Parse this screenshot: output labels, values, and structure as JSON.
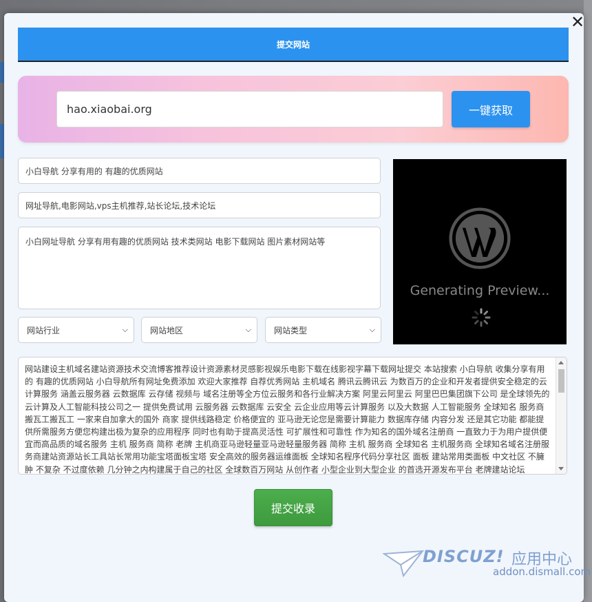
{
  "dialog": {
    "title": "提交网站",
    "close_symbol": "✕"
  },
  "fetch": {
    "url_value": "hao.xiaobai.org",
    "button_label": "一键获取"
  },
  "form": {
    "site_title": "小白导航 分享有用的 有趣的优质网站",
    "keywords": "网址导航,电影网站,vps主机推荐,站长论坛,技术论坛",
    "description": "小白网址导航 分享有用有趣的优质网站 技术类网站 电影下载网站 图片素材网站等",
    "industry_select": "网站行业",
    "region_select": "网站地区",
    "type_select": "网站类型"
  },
  "preview": {
    "status_text": "Generating Preview...",
    "icon": "wordpress-logo"
  },
  "content": {
    "text": "网站建设主机域名建站资源技术交流博客推荐设计资源素材灵感影视娱乐电影下载在线影视字幕下载网址提交 本站搜索 小白导航 收集分享有用的 有趣的优质网站 小白导航所有网址免费添加 欢迎大家推荐 自荐优秀网站 主机域名 腾讯云腾讯云 为数百万的企业和开发者提供安全稳定的云计算服务 涵盖云服务器 云数据库 云存储 视频与 域名注册等全方位云服务和各行业解决方案 阿里云阿里云 阿里巴巴集团旗下公司 是全球领先的云计算及人工智能科技公司之一 提供免费试用 云服务器 云数据库 云安全 云企业应用等云计算服务 以及大数据 人工智能服务 全球知名 服务商搬瓦工搬瓦工 一家来自加拿大的国外 商家 提供线路稳定 价格便宜的 亚马逊无论您是需要计算能力 数据库存储 内容分发 还是其它功能 都能提供所需服务方便您构建出极为复杂的应用程序 同时也有助于提高灵活性 可扩展性和可靠性 作为知名的国外域名注册商 一直致力于为用户提供便宜而高品质的域名服务 主机 服务商 简称 老牌 主机商亚马逊轻量亚马逊轻量服务器 简称 主机 服务商 全球知名 主机服务商 全球知名域名注册服务商建站资源站长工具站长常用功能宝塔面板宝塔 安全高效的服务器运维面板 全球知名程序代码分享社区 面板 建站常用类面板 中文社区 不臃肿 不复杂 不过度依赖 几分钟之内构建属于自己的社区 全球数百万网站 从创作者 小型企业到大型企业 的首选开源发布平台 老牌建站论坛"
  },
  "submit": {
    "button_label": "提交收录"
  },
  "watermark": {
    "brand": "DISCUZ!",
    "brand_cn": "应用中心",
    "url": "addon.dismall.com"
  },
  "colors": {
    "primary": "#2c92ef",
    "success": "#43a343",
    "modal_bg": "#f1f6fc"
  }
}
